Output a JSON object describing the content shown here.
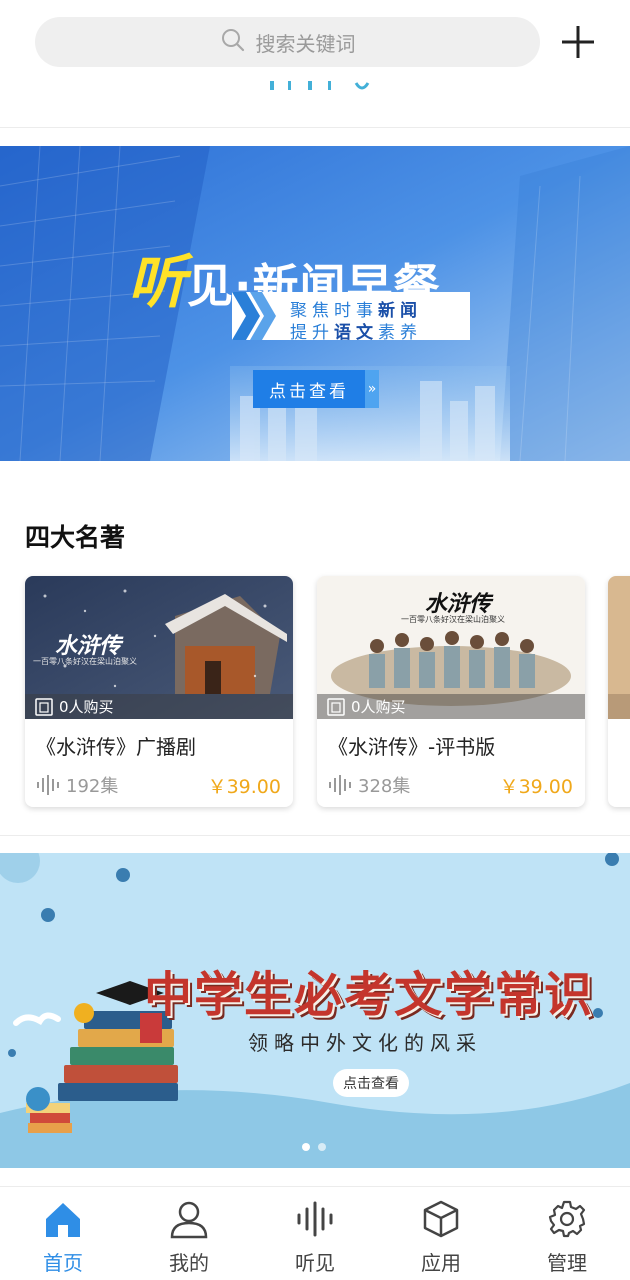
{
  "search": {
    "placeholder": "搜索关键词"
  },
  "banner_top": {
    "title_highlight": "听",
    "title_rest": "见·新闻早餐",
    "line1_a": "聚焦时事",
    "line1_b": "新闻",
    "line2_a": "提升",
    "line2_b": "语文",
    "line2_c": "素养",
    "button": "点击查看",
    "button_arrow": "»"
  },
  "section": {
    "title": "四大名著",
    "cards": [
      {
        "cover_title": "水浒传",
        "cover_caption": "一百零八条好汉在梁山泊聚义",
        "purchases": "0人购买",
        "title": "《水浒传》广播剧",
        "episodes": "192集",
        "price": "￥39.00"
      },
      {
        "cover_title": "水浒传",
        "cover_caption": "一百零八条好汉在梁山泊聚义",
        "purchases": "0人购买",
        "title": "《水浒传》-评书版",
        "episodes": "328集",
        "price": "￥39.00"
      }
    ]
  },
  "banner_bottom": {
    "title": "中学生必考文学常识",
    "subtitle": "领略中外文化的风采",
    "button": "点击查看"
  },
  "colors": {
    "accent": "#2f8ee6",
    "price": "#f0a81a"
  },
  "nav": {
    "items": [
      {
        "label": "首页",
        "icon": "home-icon",
        "active": true
      },
      {
        "label": "我的",
        "icon": "user-icon",
        "active": false
      },
      {
        "label": "听见",
        "icon": "audio-wave-icon",
        "active": false
      },
      {
        "label": "应用",
        "icon": "cube-icon",
        "active": false
      },
      {
        "label": "管理",
        "icon": "gear-icon",
        "active": false
      }
    ]
  }
}
